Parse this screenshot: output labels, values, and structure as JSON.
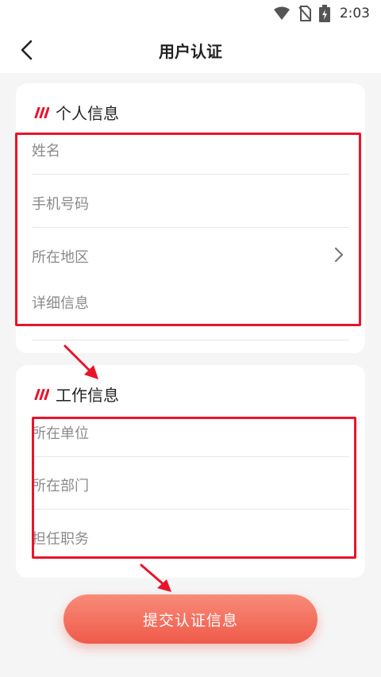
{
  "status_bar": {
    "time": "2:03",
    "icons": [
      "wifi-icon",
      "no-sim-icon",
      "battery-charging-icon"
    ]
  },
  "header": {
    "title": "用户认证",
    "back_icon": "back-arrow-icon"
  },
  "personal_section": {
    "title": "个人信息",
    "fields": {
      "name": "姓名",
      "phone": "手机号码",
      "region": "所在地区",
      "details": "详细信息"
    }
  },
  "work_section": {
    "title": "工作信息",
    "fields": {
      "company": "所在单位",
      "department": "所在部门",
      "position": "担任职务"
    }
  },
  "submit": {
    "label": "提交认证信息"
  },
  "colors": {
    "accent": "#ef5a4a",
    "annotation": "#e8142b",
    "placeholder": "#8a8a8a"
  }
}
